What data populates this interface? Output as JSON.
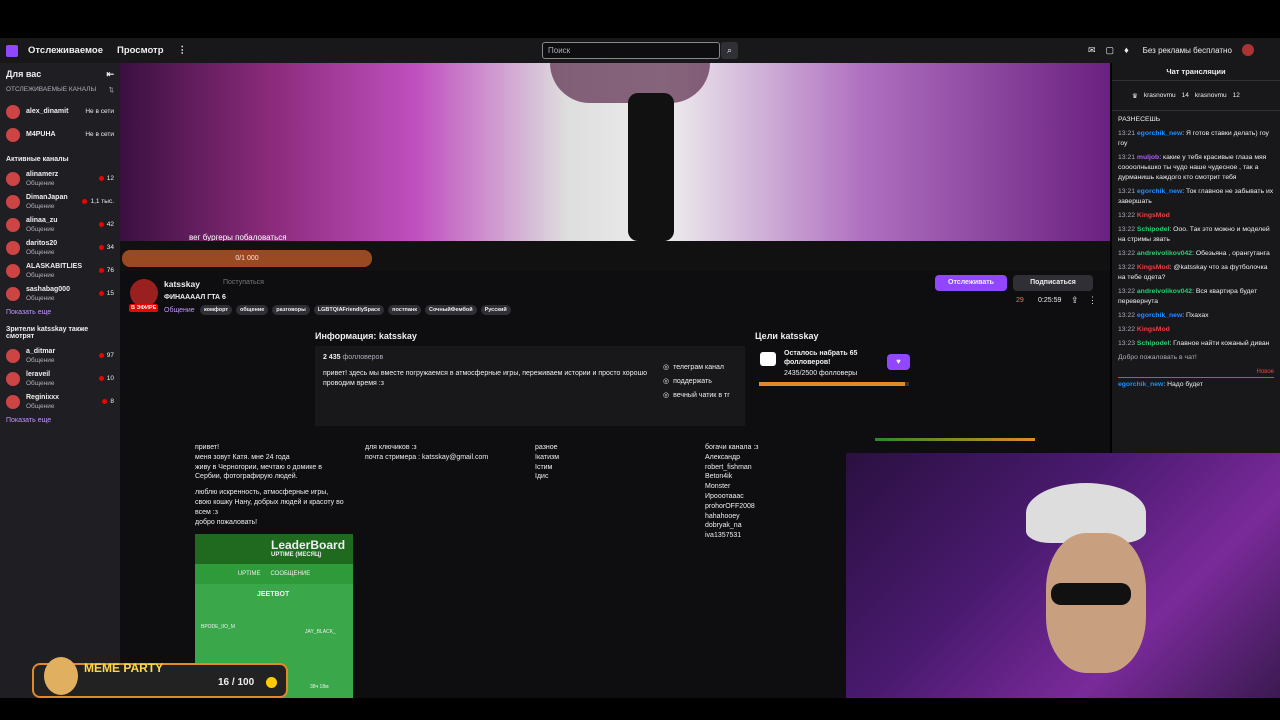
{
  "nav": {
    "following": "Отслеживаемое",
    "browse": "Просмотр",
    "more": "⋮",
    "search_placeholder": "Поиск",
    "adfree": "Без рекламы бесплатно"
  },
  "sidebar": {
    "title": "Для вас",
    "followed_label": "Отслеживаемые каналы",
    "followed": [
      {
        "name": "alex_dinamit",
        "status": "Не в сети"
      },
      {
        "name": "M4PUHA",
        "status": "Не в сети"
      }
    ],
    "active_label": "Активные каналы",
    "active": [
      {
        "name": "alinamerz",
        "cat": "Общение",
        "count": "12"
      },
      {
        "name": "DimanJapan",
        "cat": "Общение",
        "count": "1,1 тыс."
      },
      {
        "name": "alinaa_zu",
        "cat": "Общение",
        "count": "42"
      },
      {
        "name": "daritos20",
        "cat": "Общение",
        "count": "34"
      },
      {
        "name": "ALASKABITLIES",
        "cat": "Общение",
        "count": "76"
      },
      {
        "name": "sashabag000",
        "cat": "Общение",
        "count": "15"
      }
    ],
    "show_more": "Показать еще",
    "also_label": "Зрители katsskay также смотрят",
    "also": [
      {
        "name": "a_ditmar",
        "cat": "Общение",
        "count": "97"
      },
      {
        "name": "leraveil",
        "cat": "Общение",
        "count": "10"
      },
      {
        "name": "Reginixxx",
        "cat": "Общение",
        "count": "8"
      }
    ],
    "show_more2": "Показать еще"
  },
  "video": {
    "subtitle": "вег бургеры побаловаться",
    "progress": "0/1 000"
  },
  "stream": {
    "name": "katsskay",
    "soon": "Поступаться",
    "title": "ФИНААААЛ ГТА 6",
    "live": "В ЭФИРЕ",
    "category": "Общение",
    "tags": [
      "комфорт",
      "общение",
      "разговоры",
      "LGBTQIAFriendlySpace",
      "постпанк",
      "СочныйФембой",
      "Русский"
    ],
    "follow": "Отслеживать",
    "subscribe": "Подписаться",
    "viewers": "29",
    "uptime": "0:25:59"
  },
  "about": {
    "title": "Информация: katsskay",
    "followers_num": "2 435",
    "followers_label": "фолловеров",
    "desc": "привет! здесь мы вместе погружаемся в атмосферные игры, переживаем истории и просто хорошо проводим время :з",
    "links": [
      "телеграм канал",
      "поддержать",
      "вечный чатик в тг"
    ]
  },
  "goals": {
    "title": "Цели katsskay",
    "text": "Осталось набрать 65 фолловеров!",
    "num": "2435/2500 фолловеры",
    "progress": 0.974
  },
  "panels": {
    "p1": [
      "привет!",
      "меня зовут Катя. мне 24 года",
      "живу в Черногории, мечтаю о домике в",
      "Сербии, фотографирую людей.",
      "",
      "люблю искренность, атмосферные игры,",
      "свою кошку Нану, добрых людей и красоту во",
      "всем :з",
      "добро пожаловать!"
    ],
    "p2": [
      "для ключиков :з",
      "почта стримера : katsskay@gmail.com"
    ],
    "p3": [
      "разное",
      "Iкатизм",
      "Iстим",
      "Iдис"
    ],
    "p4": [
      "богачи канала :з",
      "Александр",
      "robert_fishman",
      "Beton4ik",
      "Monster",
      "Ирооотааас",
      "prohorOFF2008",
      "hahahooey",
      "dobryak_na",
      "iva1357531"
    ]
  },
  "leaderboard": {
    "title": "LeaderBoard",
    "sub": "UPTIME (МЕСЯЦ)",
    "tab1": "UPTIME",
    "tab2": "СООБЩЕНИЕ",
    "top": "JEETBOT",
    "left": "BPODE_IIO_M",
    "right": "JAY_BLACK_",
    "bottom": "38ч 18м"
  },
  "chat": {
    "title": "Чат трансляции",
    "gift1": "krasnovmu",
    "gift1cnt": "14",
    "gift2": "krasnovmu",
    "gift2cnt": "12",
    "gift3": "AHTu_Ox",
    "gift3cnt": "12",
    "messages": [
      {
        "t": "",
        "u": "",
        "c": "#fff",
        "m": "РАЗНЕСЕШЬ"
      },
      {
        "t": "13:21",
        "u": "egorchik_new",
        "c": "#1e90ff",
        "m": ": Я готов ставки делать) гоу гоу"
      },
      {
        "t": "13:21",
        "u": "muljob",
        "c": "#b05aff",
        "m": ": какие у тебя красивые глаза мяя соооолнышко ты чудо наше чудесное , так а дурманишь каждого кто смотрит тебя"
      },
      {
        "t": "13:21",
        "u": "egorchik_new",
        "c": "#1e90ff",
        "m": ": Ток главное не забывать их завершать"
      },
      {
        "t": "13:22",
        "u": "KingsMod",
        "c": "#eb4040",
        "m": ""
      },
      {
        "t": "13:22",
        "u": "Schipodel",
        "c": "#2ecc71",
        "m": ": Ооо. Так это можно и моделей на стримы звать"
      },
      {
        "t": "13:22",
        "u": "andreivolikov042",
        "c": "#2ecc71",
        "m": ": Обезьяна , орангутанга"
      },
      {
        "t": "13:22",
        "u": "KingsMod",
        "c": "#eb4040",
        "m": ": @katsskay что за футболочка на тебе одета?"
      },
      {
        "t": "13:22",
        "u": "andreivolikov042",
        "c": "#2ecc71",
        "m": ": Вся квартира будет перевернута"
      },
      {
        "t": "13:22",
        "u": "egorchik_new",
        "c": "#1e90ff",
        "m": ": Пхахах"
      },
      {
        "t": "13:22",
        "u": "KingsMod",
        "c": "#eb4040",
        "m": ""
      },
      {
        "t": "13:23",
        "u": "Schipodel",
        "c": "#2ecc71",
        "m": ": Главное найти кожаный диван"
      }
    ],
    "welcome": "Добро пожаловать в чат!",
    "newmark": "Новое",
    "last": {
      "u": "egorchik_new",
      "m": ": Надо будет"
    }
  },
  "meme": {
    "title": "MEME PARTY",
    "count": "16 / 100"
  }
}
